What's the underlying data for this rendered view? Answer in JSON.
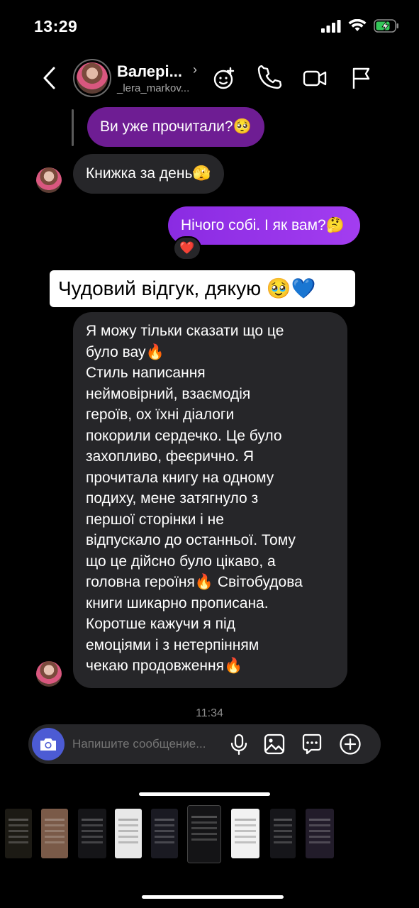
{
  "status_bar": {
    "time": "13:29",
    "icons": [
      "signal-icon",
      "wifi-icon",
      "battery-charging-icon"
    ],
    "battery_color": "#34c759"
  },
  "header": {
    "contact_name": "Валері...",
    "contact_handle": "_lera_markov...",
    "icons": [
      "back-icon",
      "chevron-right-icon",
      "effects-icon",
      "phone-icon",
      "video-icon",
      "flag-icon"
    ]
  },
  "messages": [
    {
      "side": "out",
      "text": "Ви уже прочитали?🥺"
    },
    {
      "side": "in",
      "text": "Книжка за день🫣"
    },
    {
      "side": "out",
      "text": "Нічого собі. І як вам?🤔",
      "reaction": "❤️"
    },
    {
      "side": "in",
      "text": "Я можу тільки сказати що це\nбуло вау🔥\nСтиль написання\nнеймовірний, взаємодія\nгероїв, ох їхні діалоги\nпокорили сердечко. Це було\nзахопливо, феєрично. Я\nпрочитала книгу на одному\nподиху, мене затягнуло з\nпершої сторінки і не\nвідпускало до останньої. Тому\nщо це дійсно було цікаво, а\nголовна героїня🔥 Світобудова\nкниги шикарно прописана.\nКоротше кажучи я під\nемоціями і з нетерпінням\nчекаю продовження🔥"
    }
  ],
  "caption": "Чудовий відгук, дякую 🥹💙",
  "timestamp": "11:34",
  "composer": {
    "placeholder": "Напишите сообщение...",
    "icons": [
      "camera-icon",
      "microphone-icon",
      "gallery-icon",
      "sticker-icon",
      "plus-icon"
    ],
    "camera_color": "#4c5bd4"
  },
  "colors": {
    "outgoing_bubble": "#a33df0",
    "outgoing_quoted_bubble": "#6e1d93",
    "incoming_bubble": "#262629",
    "background": "#000000"
  }
}
